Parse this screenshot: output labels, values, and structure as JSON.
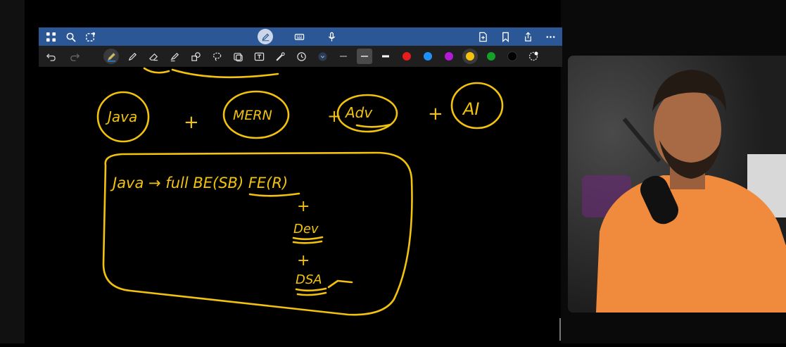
{
  "colors": {
    "top_bar": "#2b5797",
    "tool_bar": "#1f1f1f",
    "ink": "#f2c20f",
    "background": "#000000"
  },
  "top_bar": {
    "left_icons": [
      "grid-icon",
      "search-icon",
      "lasso-share-icon"
    ],
    "center_icons": [
      "pen-mode-icon",
      "keyboard-icon",
      "microphone-icon"
    ],
    "right_icons": [
      "add-page-icon",
      "bookmark-icon",
      "share-icon",
      "more-icon"
    ]
  },
  "tool_bar": {
    "history_icons": [
      "undo-icon",
      "redo-icon"
    ],
    "tools": [
      "pen-tool-icon",
      "pencil-tool-icon",
      "eraser-tool-icon",
      "highlighter-tool-icon",
      "shapes-tool-icon",
      "lasso-tool-icon",
      "sticker-tool-icon",
      "text-tool-icon",
      "laser-pointer-icon",
      "timer-icon",
      "chevron-down-icon"
    ],
    "swatches": [
      "#e81c1c",
      "#1e90ff",
      "#b21bd6",
      "#f2c20f",
      "#16a02a",
      "#000000",
      "#ffffff"
    ],
    "selected_swatch": "#f2c20f"
  },
  "canvas": {
    "words": [
      "Java",
      "+",
      "MERN",
      "+",
      "Adv",
      "+",
      "AI"
    ],
    "box_line": "Java → full BE(SB)  FE(R)",
    "stack": [
      "+",
      "Dev",
      "+",
      "DSA"
    ]
  },
  "webcam": {
    "label": "presenter-webcam"
  }
}
